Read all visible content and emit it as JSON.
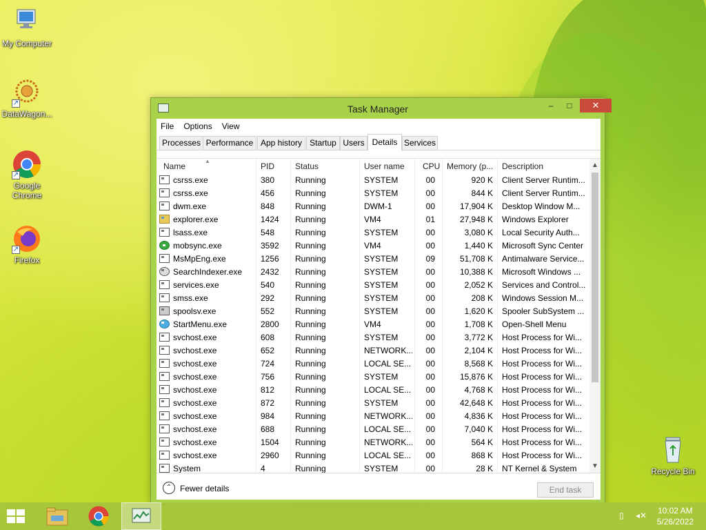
{
  "desktop": {
    "icons": [
      {
        "label": "My Computer"
      },
      {
        "label": "DataWagon..."
      },
      {
        "label": "Google Chrome"
      },
      {
        "label": "Firefox"
      },
      {
        "label": "Recycle Bin"
      }
    ]
  },
  "window": {
    "title": "Task Manager",
    "controls": {
      "minimize": "–",
      "maximize": "□",
      "close": "✕"
    },
    "menu": [
      "File",
      "Options",
      "View"
    ],
    "tabs": [
      "Processes",
      "Performance",
      "App history",
      "Startup",
      "Users",
      "Details",
      "Services"
    ],
    "active_tab": "Details",
    "columns": [
      "Name",
      "PID",
      "Status",
      "User name",
      "CPU",
      "Memory (p...",
      "Description"
    ],
    "rows": [
      {
        "icon": "window",
        "name": "csrss.exe",
        "pid": "380",
        "status": "Running",
        "user": "SYSTEM",
        "cpu": "00",
        "mem": "920 K",
        "desc": "Client Server Runtim..."
      },
      {
        "icon": "window",
        "name": "csrss.exe",
        "pid": "456",
        "status": "Running",
        "user": "SYSTEM",
        "cpu": "00",
        "mem": "844 K",
        "desc": "Client Server Runtim..."
      },
      {
        "icon": "window",
        "name": "dwm.exe",
        "pid": "848",
        "status": "Running",
        "user": "DWM-1",
        "cpu": "00",
        "mem": "17,904 K",
        "desc": "Desktop Window M..."
      },
      {
        "icon": "folder",
        "name": "explorer.exe",
        "pid": "1424",
        "status": "Running",
        "user": "VM4",
        "cpu": "01",
        "mem": "27,948 K",
        "desc": "Windows Explorer"
      },
      {
        "icon": "window",
        "name": "lsass.exe",
        "pid": "548",
        "status": "Running",
        "user": "SYSTEM",
        "cpu": "00",
        "mem": "3,080 K",
        "desc": "Local Security Auth..."
      },
      {
        "icon": "sync",
        "name": "mobsync.exe",
        "pid": "3592",
        "status": "Running",
        "user": "VM4",
        "cpu": "00",
        "mem": "1,440 K",
        "desc": "Microsoft Sync Center"
      },
      {
        "icon": "window",
        "name": "MsMpEng.exe",
        "pid": "1256",
        "status": "Running",
        "user": "SYSTEM",
        "cpu": "09",
        "mem": "51,708 K",
        "desc": "Antimalware Service..."
      },
      {
        "icon": "search",
        "name": "SearchIndexer.exe",
        "pid": "2432",
        "status": "Running",
        "user": "SYSTEM",
        "cpu": "00",
        "mem": "10,388 K",
        "desc": "Microsoft Windows ..."
      },
      {
        "icon": "window",
        "name": "services.exe",
        "pid": "540",
        "status": "Running",
        "user": "SYSTEM",
        "cpu": "00",
        "mem": "2,052 K",
        "desc": "Services and Control..."
      },
      {
        "icon": "window",
        "name": "smss.exe",
        "pid": "292",
        "status": "Running",
        "user": "SYSTEM",
        "cpu": "00",
        "mem": "208 K",
        "desc": "Windows Session M..."
      },
      {
        "icon": "printer",
        "name": "spoolsv.exe",
        "pid": "552",
        "status": "Running",
        "user": "SYSTEM",
        "cpu": "00",
        "mem": "1,620 K",
        "desc": "Spooler SubSystem ..."
      },
      {
        "icon": "shell",
        "name": "StartMenu.exe",
        "pid": "2800",
        "status": "Running",
        "user": "VM4",
        "cpu": "00",
        "mem": "1,708 K",
        "desc": "Open-Shell Menu"
      },
      {
        "icon": "window",
        "name": "svchost.exe",
        "pid": "608",
        "status": "Running",
        "user": "SYSTEM",
        "cpu": "00",
        "mem": "3,772 K",
        "desc": "Host Process for Wi..."
      },
      {
        "icon": "window",
        "name": "svchost.exe",
        "pid": "652",
        "status": "Running",
        "user": "NETWORK...",
        "cpu": "00",
        "mem": "2,104 K",
        "desc": "Host Process for Wi..."
      },
      {
        "icon": "window",
        "name": "svchost.exe",
        "pid": "724",
        "status": "Running",
        "user": "LOCAL SE...",
        "cpu": "00",
        "mem": "8,568 K",
        "desc": "Host Process for Wi..."
      },
      {
        "icon": "window",
        "name": "svchost.exe",
        "pid": "756",
        "status": "Running",
        "user": "SYSTEM",
        "cpu": "00",
        "mem": "15,876 K",
        "desc": "Host Process for Wi..."
      },
      {
        "icon": "window",
        "name": "svchost.exe",
        "pid": "812",
        "status": "Running",
        "user": "LOCAL SE...",
        "cpu": "00",
        "mem": "4,768 K",
        "desc": "Host Process for Wi..."
      },
      {
        "icon": "window",
        "name": "svchost.exe",
        "pid": "872",
        "status": "Running",
        "user": "SYSTEM",
        "cpu": "00",
        "mem": "42,648 K",
        "desc": "Host Process for Wi..."
      },
      {
        "icon": "window",
        "name": "svchost.exe",
        "pid": "984",
        "status": "Running",
        "user": "NETWORK...",
        "cpu": "00",
        "mem": "4,836 K",
        "desc": "Host Process for Wi..."
      },
      {
        "icon": "window",
        "name": "svchost.exe",
        "pid": "688",
        "status": "Running",
        "user": "LOCAL SE...",
        "cpu": "00",
        "mem": "7,040 K",
        "desc": "Host Process for Wi..."
      },
      {
        "icon": "window",
        "name": "svchost.exe",
        "pid": "1504",
        "status": "Running",
        "user": "NETWORK...",
        "cpu": "00",
        "mem": "564 K",
        "desc": "Host Process for Wi..."
      },
      {
        "icon": "window",
        "name": "svchost.exe",
        "pid": "2960",
        "status": "Running",
        "user": "LOCAL SE...",
        "cpu": "00",
        "mem": "868 K",
        "desc": "Host Process for Wi..."
      },
      {
        "icon": "window",
        "name": "System",
        "pid": "4",
        "status": "Running",
        "user": "SYSTEM",
        "cpu": "00",
        "mem": "28 K",
        "desc": "NT Kernel & System"
      }
    ],
    "footer": {
      "fewer_details": "Fewer details",
      "end_task": "End task"
    }
  },
  "taskbar": {
    "clock_time": "10:02 AM",
    "clock_date": "5/26/2022"
  },
  "colors": {
    "accent": "#a8d24a",
    "close": "#c84a3a",
    "taskbar": "#a5c43c"
  }
}
